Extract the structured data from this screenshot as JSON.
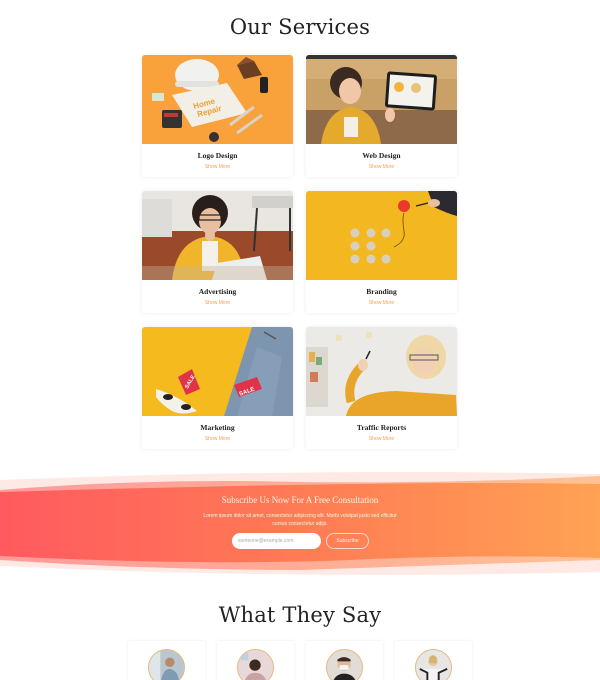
{
  "services": {
    "title": "Our Services",
    "items": [
      {
        "name": "Logo Design",
        "link": "Show More",
        "image": "home-repair-tools-photo"
      },
      {
        "name": "Web Design",
        "link": "Show More",
        "image": "woman-holding-tablet-photo"
      },
      {
        "name": "Advertising",
        "link": "Show More",
        "image": "woman-thinking-at-laptop-photo"
      },
      {
        "name": "Branding",
        "link": "Show More",
        "image": "wooden-pegs-red-circle-photo"
      },
      {
        "name": "Marketing",
        "link": "Show More",
        "image": "sale-tags-jeans-sunglasses-photo"
      },
      {
        "name": "Traffic Reports",
        "link": "Show More",
        "image": "woman-writing-on-glass-photo"
      }
    ]
  },
  "subscribe": {
    "title": "Subscribe Us Now For A Free Consultation",
    "text": "Lorem ipsum dolor sit amet, consectetur adipiscing elit. Morbi volutpat justo sed efficitur cursus consectetur adipi.",
    "email_placeholder": "someone@example.com",
    "button_label": "Subscribe",
    "gradient_start": "#ff5a5f",
    "gradient_end": "#ffa254"
  },
  "testimonials": {
    "title": "What They Say",
    "avatars": [
      {
        "image": "man-in-office-avatar"
      },
      {
        "image": "man-smiling-avatar"
      },
      {
        "image": "man-with-mask-avatar"
      },
      {
        "image": "woman-arms-raised-avatar"
      }
    ]
  },
  "colors": {
    "accent": "#f3a14f",
    "heading": "#222222"
  }
}
